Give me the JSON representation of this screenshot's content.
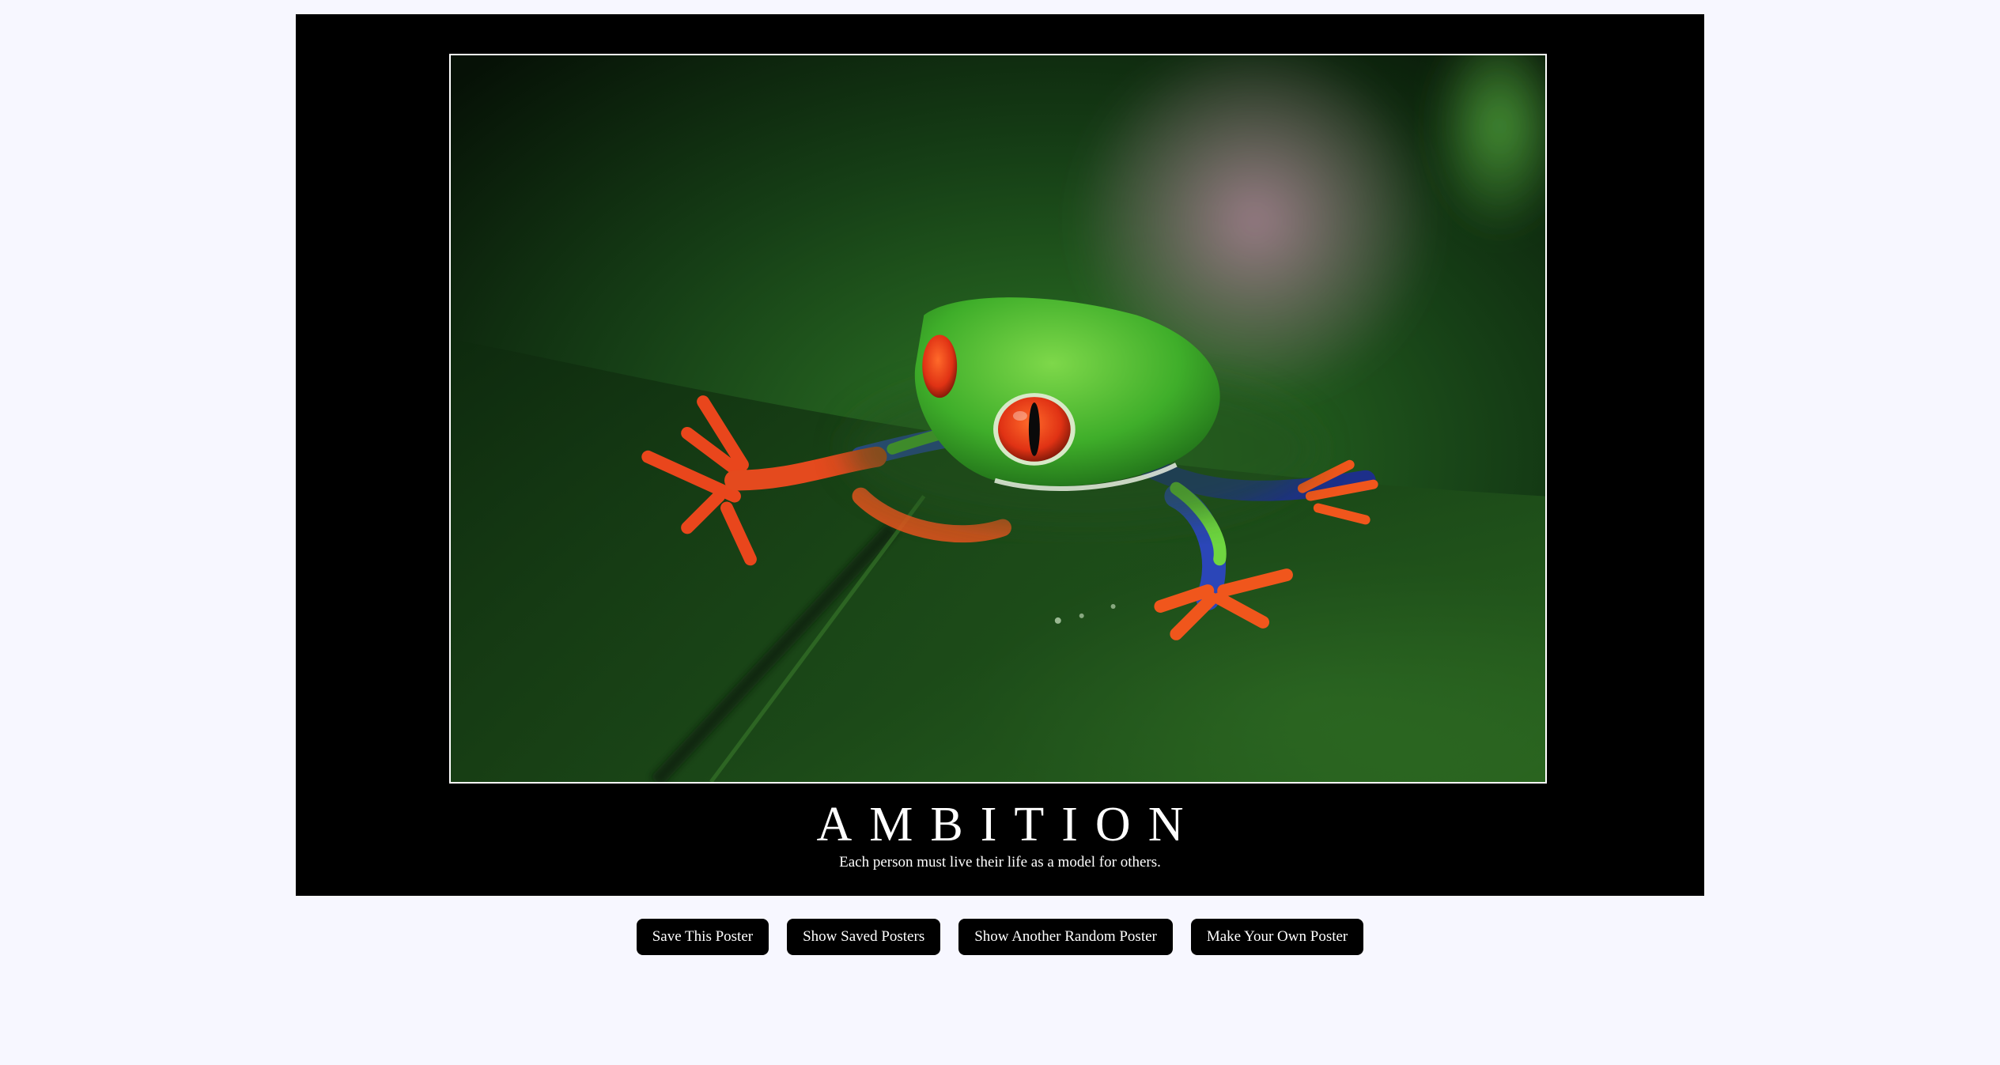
{
  "poster": {
    "title": "AMBITION",
    "quote": "Each person must live their life as a model for others.",
    "image_subject": "red-eyed tree frog on green leaf"
  },
  "buttons": {
    "save_label": "Save This Poster",
    "show_saved_label": "Show Saved Posters",
    "random_label": "Show Another Random Poster",
    "make_own_label": "Make Your Own Poster"
  },
  "colors": {
    "page_background": "#f7f7ff",
    "poster_background": "#000000",
    "button_background": "#000000",
    "button_text": "#ffffff",
    "frame_border": "#ffffff"
  }
}
